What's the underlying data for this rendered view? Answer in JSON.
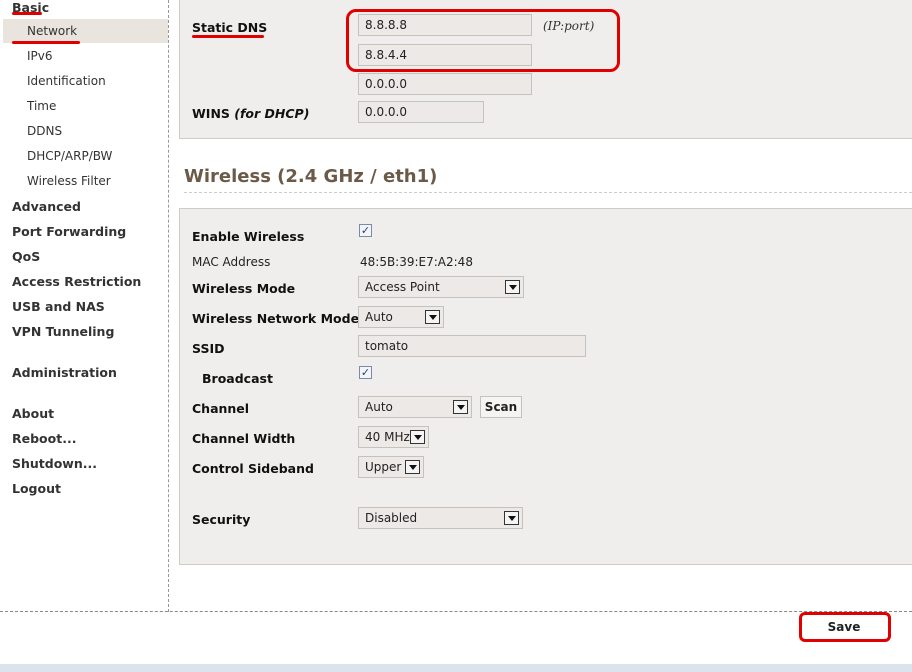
{
  "sidebar": {
    "basic": "Basic",
    "basic_items": [
      "Network",
      "IPv6",
      "Identification",
      "Time",
      "DDNS",
      "DHCP/ARP/BW",
      "Wireless Filter"
    ],
    "advanced": "Advanced",
    "port_forwarding": "Port Forwarding",
    "qos": "QoS",
    "access_restriction": "Access Restriction",
    "usb_nas": "USB and NAS",
    "vpn": "VPN Tunneling",
    "administration": "Administration",
    "about": "About",
    "reboot": "Reboot...",
    "shutdown": "Shutdown...",
    "logout": "Logout"
  },
  "dns": {
    "label": "Static DNS",
    "hint": "(IP:port)",
    "dns1": "8.8.8.8",
    "dns2": "8.8.4.4",
    "dns3": "0.0.0.0",
    "wins_label": "WINS",
    "wins_suffix": "(for DHCP)",
    "wins": "0.0.0.0"
  },
  "wireless": {
    "title": "Wireless (2.4 GHz / eth1)",
    "enable_label": "Enable Wireless",
    "enable_checked": true,
    "mac_label": "MAC Address",
    "mac": "48:5B:39:E7:A2:48",
    "mode_label": "Wireless Mode",
    "mode": "Access Point",
    "net_mode_label": "Wireless Network Mode",
    "net_mode": "Auto",
    "ssid_label": "SSID",
    "ssid": "tomato",
    "broadcast_label": "Broadcast",
    "broadcast_checked": true,
    "channel_label": "Channel",
    "channel": "Auto",
    "scan_label": "Scan",
    "width_label": "Channel Width",
    "width": "40 MHz",
    "sideband_label": "Control Sideband",
    "sideband": "Upper",
    "security_label": "Security",
    "security": "Disabled"
  },
  "save_label": "Save",
  "colors": {
    "annotation_red": "#e00000",
    "title_brown": "#6b5a48",
    "panel_bg": "#f0eeec"
  }
}
